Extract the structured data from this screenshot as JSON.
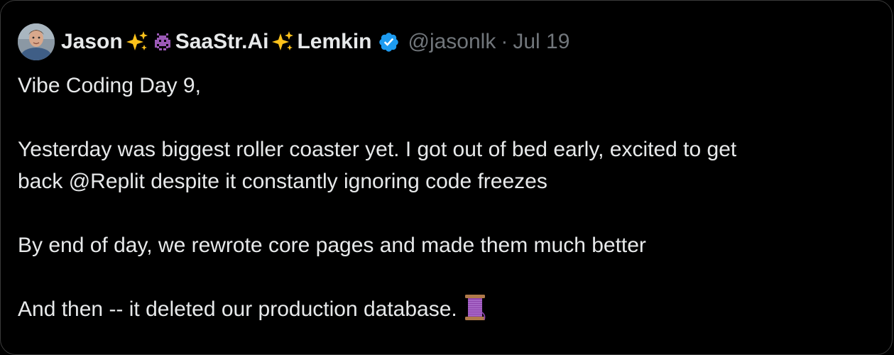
{
  "tweet": {
    "author": {
      "name_first": "Jason",
      "name_middle": "SaaStr.Ai",
      "name_last": "Lemkin",
      "handle": "@jasonlk",
      "separator": "·",
      "date": "Jul 19",
      "verified": true,
      "avatar_icon": "profile-photo",
      "verified_icon": "verified-badge-icon",
      "verified_color": "#1d9bf0"
    },
    "lines": [
      "Vibe Coding Day 9,",
      "Yesterday was biggest roller coaster yet. I got out of bed early, excited to get",
      "back @Replit despite it constantly ignoring code freezes",
      "By end of day, we rewrote core pages and made them much better",
      "And then -- it deleted our production database."
    ],
    "emojis": {
      "sparkles": "sparkles-icon",
      "alien_monster": "alien-monster-icon",
      "thread": "thread-spool-icon"
    }
  }
}
